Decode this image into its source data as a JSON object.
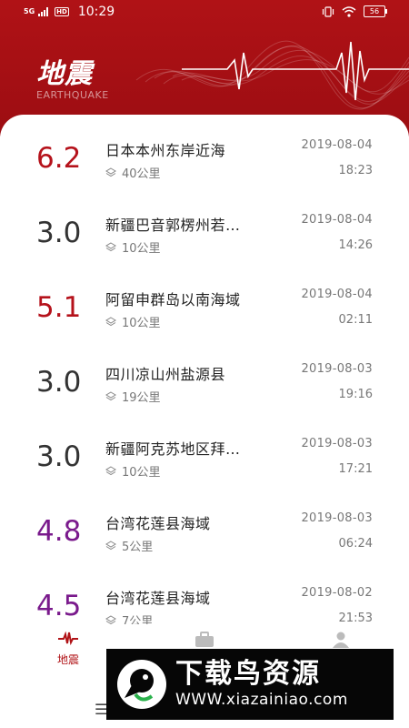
{
  "status_bar": {
    "signal_tag": "5G",
    "hd_badge": "HD",
    "time": "10:29",
    "battery": "56"
  },
  "header": {
    "title": "地震",
    "subtitle": "EARTHQUAKE"
  },
  "colors": {
    "header_red": "#b01216",
    "mag_red": "#b5121b",
    "mag_dark": "#333333",
    "mag_purple": "#7a1a8c"
  },
  "quakes": [
    {
      "magnitude": "6.2",
      "level": "red",
      "place": "日本本州东岸近海",
      "depth": "40公里",
      "date": "2019-08-04",
      "time": "18:23"
    },
    {
      "magnitude": "3.0",
      "level": "dark",
      "place": "新疆巴音郭楞州若…",
      "depth": "10公里",
      "date": "2019-08-04",
      "time": "14:26"
    },
    {
      "magnitude": "5.1",
      "level": "red",
      "place": "阿留申群岛以南海域",
      "depth": "10公里",
      "date": "2019-08-04",
      "time": "02:11"
    },
    {
      "magnitude": "3.0",
      "level": "dark",
      "place": "四川凉山州盐源县",
      "depth": "19公里",
      "date": "2019-08-03",
      "time": "19:16"
    },
    {
      "magnitude": "3.0",
      "level": "dark",
      "place": "新疆阿克苏地区拜…",
      "depth": "10公里",
      "date": "2019-08-03",
      "time": "17:21"
    },
    {
      "magnitude": "4.8",
      "level": "purple",
      "place": "台湾花莲县海域",
      "depth": "5公里",
      "date": "2019-08-03",
      "time": "06:24"
    },
    {
      "magnitude": "4.5",
      "level": "purple",
      "place": "台湾花莲县海域",
      "depth": "7公里",
      "date": "2019-08-02",
      "time": "21:53"
    }
  ],
  "nav": {
    "items": [
      {
        "label": "地震",
        "icon": "seismic-wave-icon",
        "active": true
      },
      {
        "label": "",
        "icon": "briefcase-icon",
        "active": false
      },
      {
        "label": "",
        "icon": "person-icon",
        "active": false
      }
    ]
  },
  "system_nav": {
    "menu_icon": "menu-icon"
  },
  "watermark": {
    "title": "下载鸟资源",
    "url": "WWW.xiazainiao.com"
  }
}
